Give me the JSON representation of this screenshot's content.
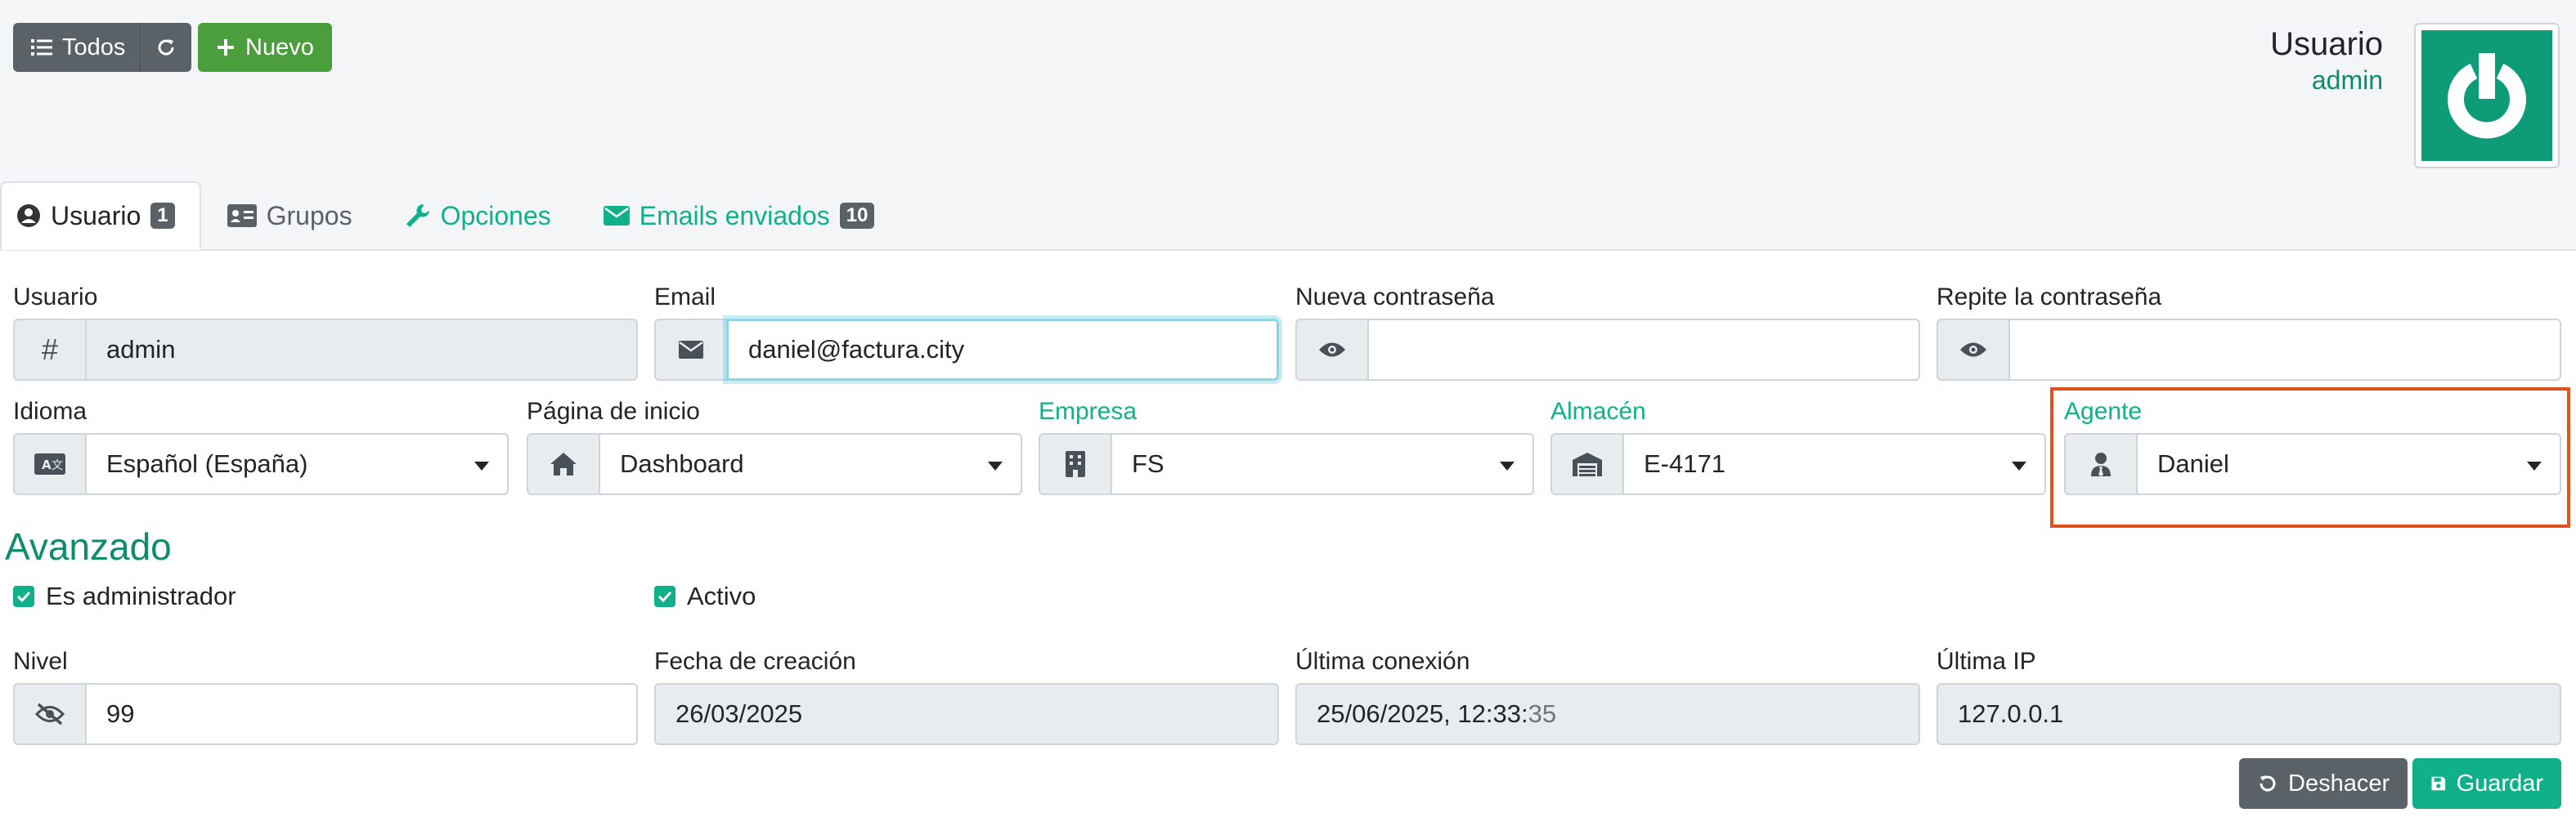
{
  "toolbar": {
    "all_label": "Todos",
    "new_label": "Nuevo",
    "refresh_icon": "refresh-icon",
    "list_icon": "list-icon",
    "plus_icon": "plus-icon"
  },
  "header": {
    "title": "Usuario",
    "subtitle": "admin",
    "logo_icon": "power-logo-icon"
  },
  "tabs": [
    {
      "label": "Usuario",
      "badge": "1",
      "icon": "user-circle-icon"
    },
    {
      "label": "Grupos",
      "icon": "id-card-icon"
    },
    {
      "label": "Opciones",
      "icon": "wrench-icon"
    },
    {
      "label": "Emails enviados",
      "badge": "10",
      "icon": "envelope-icon"
    }
  ],
  "form": {
    "usuario": {
      "label": "Usuario",
      "value": "admin",
      "icon": "hash-icon"
    },
    "email": {
      "label": "Email",
      "value": "daniel@factura.city",
      "icon": "envelope-icon"
    },
    "nueva_contrasena": {
      "label": "Nueva contraseña",
      "value": "",
      "icon": "eye-icon"
    },
    "repite_contrasena": {
      "label": "Repite la contraseña",
      "value": "",
      "icon": "eye-icon"
    },
    "idioma": {
      "label": "Idioma",
      "value": "Español (España)",
      "icon": "language-icon"
    },
    "pagina_inicio": {
      "label": "Página de inicio",
      "value": "Dashboard",
      "icon": "home-icon"
    },
    "empresa": {
      "label": "Empresa",
      "value": "FS",
      "icon": "building-icon"
    },
    "almacen": {
      "label": "Almacén",
      "value": "E-4171",
      "icon": "warehouse-icon"
    },
    "agente": {
      "label": "Agente",
      "value": "Daniel",
      "icon": "user-tie-icon"
    }
  },
  "advanced": {
    "title": "Avanzado",
    "es_admin": {
      "label": "Es administrador",
      "checked": true
    },
    "activo": {
      "label": "Activo",
      "checked": true
    },
    "nivel": {
      "label": "Nivel",
      "value": "99",
      "icon": "eye-slash-icon"
    },
    "fecha_creacion": {
      "label": "Fecha de creación",
      "value": "26/03/2025"
    },
    "ultima_conexion": {
      "label": "Última conexión",
      "value_main": "25/06/2025, 12:33:",
      "value_secs": "35"
    },
    "ultima_ip": {
      "label": "Última IP",
      "value": "127.0.0.1"
    }
  },
  "actions": {
    "undo_label": "Deshacer",
    "save_label": "Guardar"
  },
  "colors": {
    "accent": "#10b08b",
    "highlight": "#e0521f",
    "secondary": "#5a6268"
  }
}
